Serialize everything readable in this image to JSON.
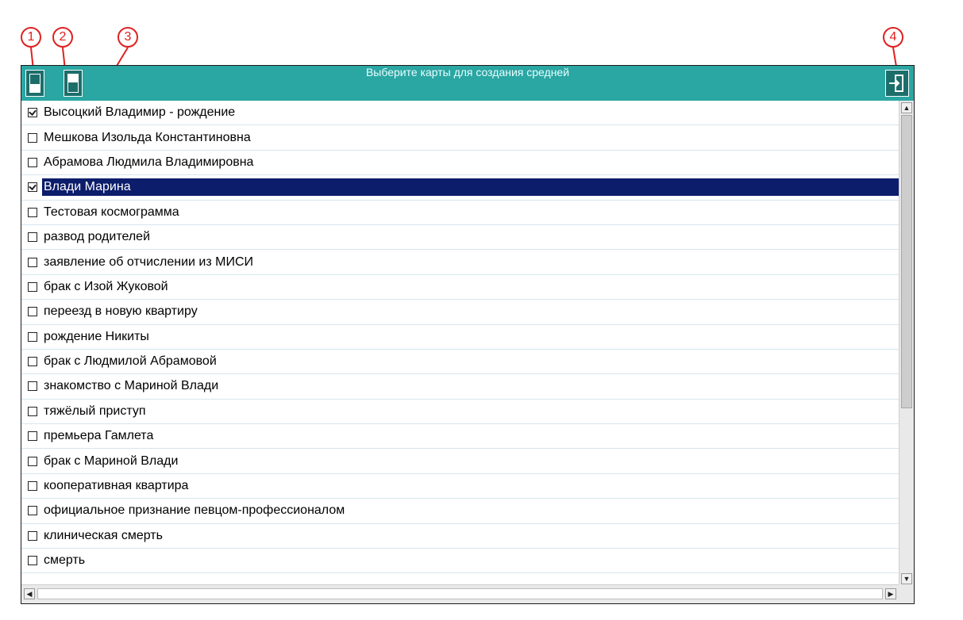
{
  "window": {
    "title": "Выберите карты для создания средней"
  },
  "callouts": [
    "1",
    "2",
    "3",
    "4"
  ],
  "icons": {
    "select_all": "select-all-icon",
    "deselect_all": "deselect-all-icon",
    "exit": "exit-icon"
  },
  "colors": {
    "titlebar": "#2aa6a3",
    "selection": "#0c1d6b",
    "callout": "#e02020"
  },
  "list": {
    "items": [
      {
        "label": "Высоцкий Владимир - рождение",
        "checked": true,
        "selected": false
      },
      {
        "label": "Мешкова Изольда Константиновна",
        "checked": false,
        "selected": false
      },
      {
        "label": "Абрамова Людмила Владимировна",
        "checked": false,
        "selected": false
      },
      {
        "label": "Влади Марина",
        "checked": true,
        "selected": true
      },
      {
        "label": "Тестовая космограмма",
        "checked": false,
        "selected": false
      },
      {
        "label": "развод родителей",
        "checked": false,
        "selected": false
      },
      {
        "label": "заявление об отчислении из МИСИ",
        "checked": false,
        "selected": false
      },
      {
        "label": "брак с Изой Жуковой",
        "checked": false,
        "selected": false
      },
      {
        "label": "переезд в новую квартиру",
        "checked": false,
        "selected": false
      },
      {
        "label": "рождение Никиты",
        "checked": false,
        "selected": false
      },
      {
        "label": "брак с Людмилой Абрамовой",
        "checked": false,
        "selected": false
      },
      {
        "label": "знакомство с Мариной Влади",
        "checked": false,
        "selected": false
      },
      {
        "label": "тяжёлый приступ",
        "checked": false,
        "selected": false
      },
      {
        "label": "премьера Гамлета",
        "checked": false,
        "selected": false
      },
      {
        "label": "брак с Мариной Влади",
        "checked": false,
        "selected": false
      },
      {
        "label": "кооперативная квартира",
        "checked": false,
        "selected": false
      },
      {
        "label": "официальное признание певцом-профессионалом",
        "checked": false,
        "selected": false
      },
      {
        "label": "клиническая смерть",
        "checked": false,
        "selected": false
      },
      {
        "label": "смерть",
        "checked": false,
        "selected": false
      }
    ]
  }
}
